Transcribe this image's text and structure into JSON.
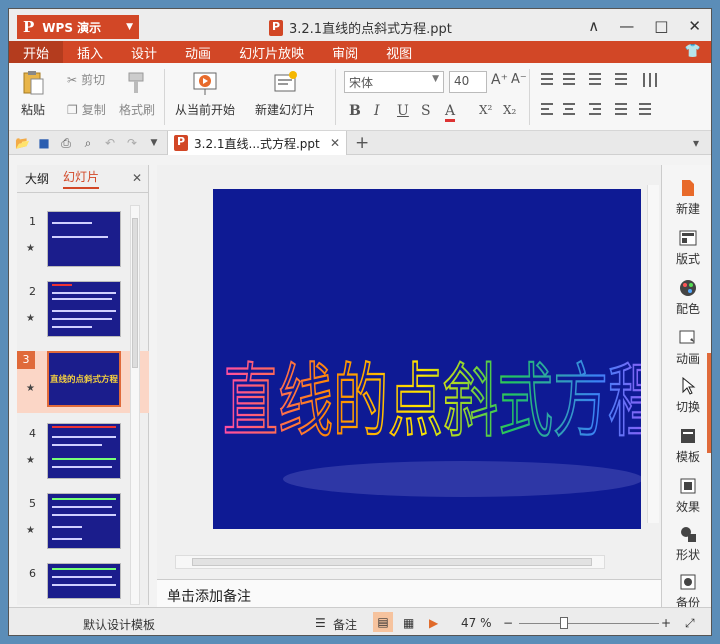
{
  "app": {
    "name": "WPS 演示",
    "logo": "P"
  },
  "window": {
    "title": "3.2.1直线的点斜式方程.ppt",
    "controls": [
      "∧",
      "—",
      "□",
      "✕"
    ]
  },
  "tabs": [
    "开始",
    "插入",
    "设计",
    "动画",
    "幻灯片放映",
    "审阅",
    "视图"
  ],
  "active_tab": "开始",
  "ribbon": {
    "paste": "粘贴",
    "cut": "剪切",
    "copy": "复制",
    "format_painter": "格式刷",
    "from_current": "从当前开始",
    "new_slide": "新建幻灯片",
    "font_name": "宋体",
    "font_size": "40",
    "format_buttons": [
      "B",
      "I",
      "U",
      "S",
      "A",
      "X²",
      "X₂"
    ]
  },
  "doc_tab": {
    "label": "3.2.1直线...式方程.ppt"
  },
  "left_panel": {
    "tabs": [
      "大纲",
      "幻灯片"
    ],
    "active": "幻灯片",
    "thumbnails": [
      {
        "num": "1"
      },
      {
        "num": "2"
      },
      {
        "num": "3",
        "title": "直线的点斜式方程"
      },
      {
        "num": "4"
      },
      {
        "num": "5"
      },
      {
        "num": "6"
      }
    ]
  },
  "slide": {
    "title": "直线的点斜式方程",
    "background": "#0e1a94"
  },
  "notes_placeholder": "单击添加备注",
  "right_bar": [
    "新建",
    "版式",
    "配色",
    "动画",
    "切换",
    "模板",
    "效果",
    "形状",
    "备份"
  ],
  "status": {
    "template": "默认设计模板",
    "notes": "备注",
    "zoom": "47 %",
    "zoom_level": 0.47
  }
}
